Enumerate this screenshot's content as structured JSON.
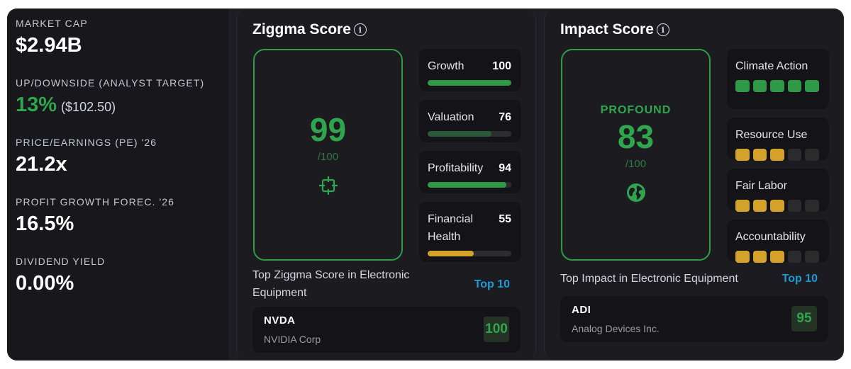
{
  "stats": [
    {
      "label": "MARKET CAP",
      "value": "$2.94B"
    },
    {
      "label": "UP/DOWNSIDE (ANALYST TARGET)",
      "value": "13%",
      "sub": "($102.50)"
    },
    {
      "label": "PRICE/EARNINGS (PE) '26",
      "value": "21.2x"
    },
    {
      "label": "PROFIT GROWTH FOREC. '26",
      "value": "16.5%"
    },
    {
      "label": "DIVIDEND YIELD",
      "value": "0.00%"
    }
  ],
  "ziggma": {
    "title": "Ziggma Score",
    "score": "99",
    "denominator": "/100",
    "icon": "target-crosshair-icon",
    "components": [
      {
        "name": "Growth",
        "value": "100",
        "fill": 100,
        "color": "#2e9a48"
      },
      {
        "name": "Valuation",
        "value": "76",
        "fill": 76,
        "color": "#2a5a3a"
      },
      {
        "name": "Profitability",
        "value": "94",
        "fill": 94,
        "color": "#2e9a48"
      },
      {
        "name": "Financial Health",
        "value": "55",
        "fill": 55,
        "color": "#d4a22a"
      }
    ],
    "top_text": "Top Ziggma Score in Electronic Equipment",
    "top_badge": "Top 10",
    "top_company": {
      "ticker": "NVDA",
      "name": "NVIDIA Corp",
      "score": "100"
    }
  },
  "impact": {
    "title": "Impact Score",
    "tag": "PROFOUND",
    "score": "83",
    "denominator": "/100",
    "icon": "globe-icon",
    "components": [
      {
        "name": "Climate Action",
        "level": 5,
        "color": "#2e9a48"
      },
      {
        "name": "Resource Use",
        "level": 3,
        "color": "#d4a22a"
      },
      {
        "name": "Fair Labor",
        "level": 3,
        "color": "#d4a22a"
      },
      {
        "name": "Accountability",
        "level": 3,
        "color": "#d4a22a"
      }
    ],
    "top_text": "Top Impact in Electronic Equipment",
    "top_badge": "Top 10",
    "top_company": {
      "ticker": "ADI",
      "name": "Analog Devices Inc.",
      "score": "95"
    }
  }
}
